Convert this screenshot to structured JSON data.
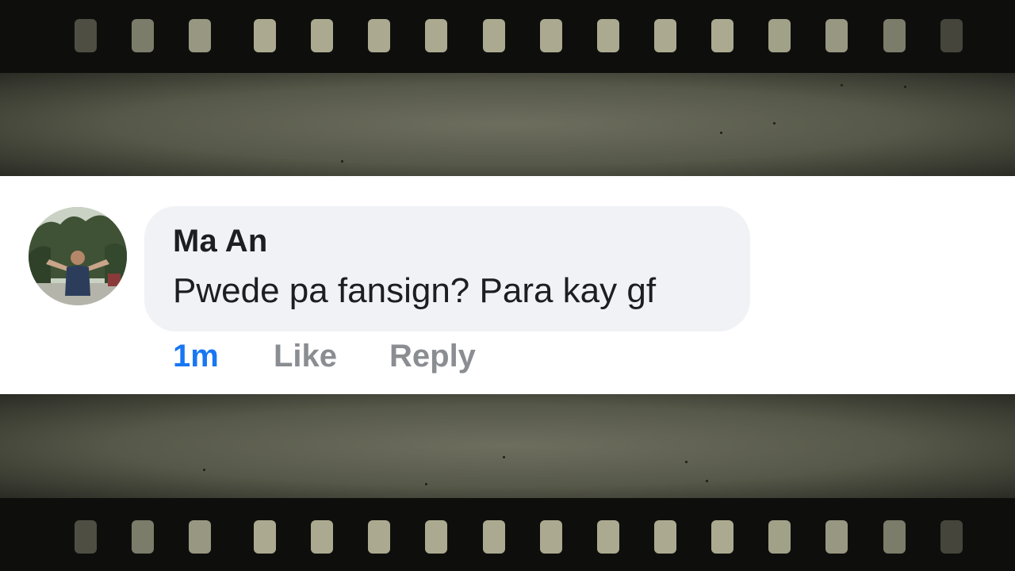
{
  "comment": {
    "author": "Ma An",
    "text": "Pwede pa fansign? Para kay gf",
    "timestamp": "1m",
    "like_label": "Like",
    "reply_label": "Reply"
  },
  "icons": {
    "avatar": "profile-photo"
  },
  "colors": {
    "timestamp": "#1877f2",
    "action": "#8a8d91",
    "bubble": "#f0f2f5",
    "author": "#1c1e21"
  }
}
